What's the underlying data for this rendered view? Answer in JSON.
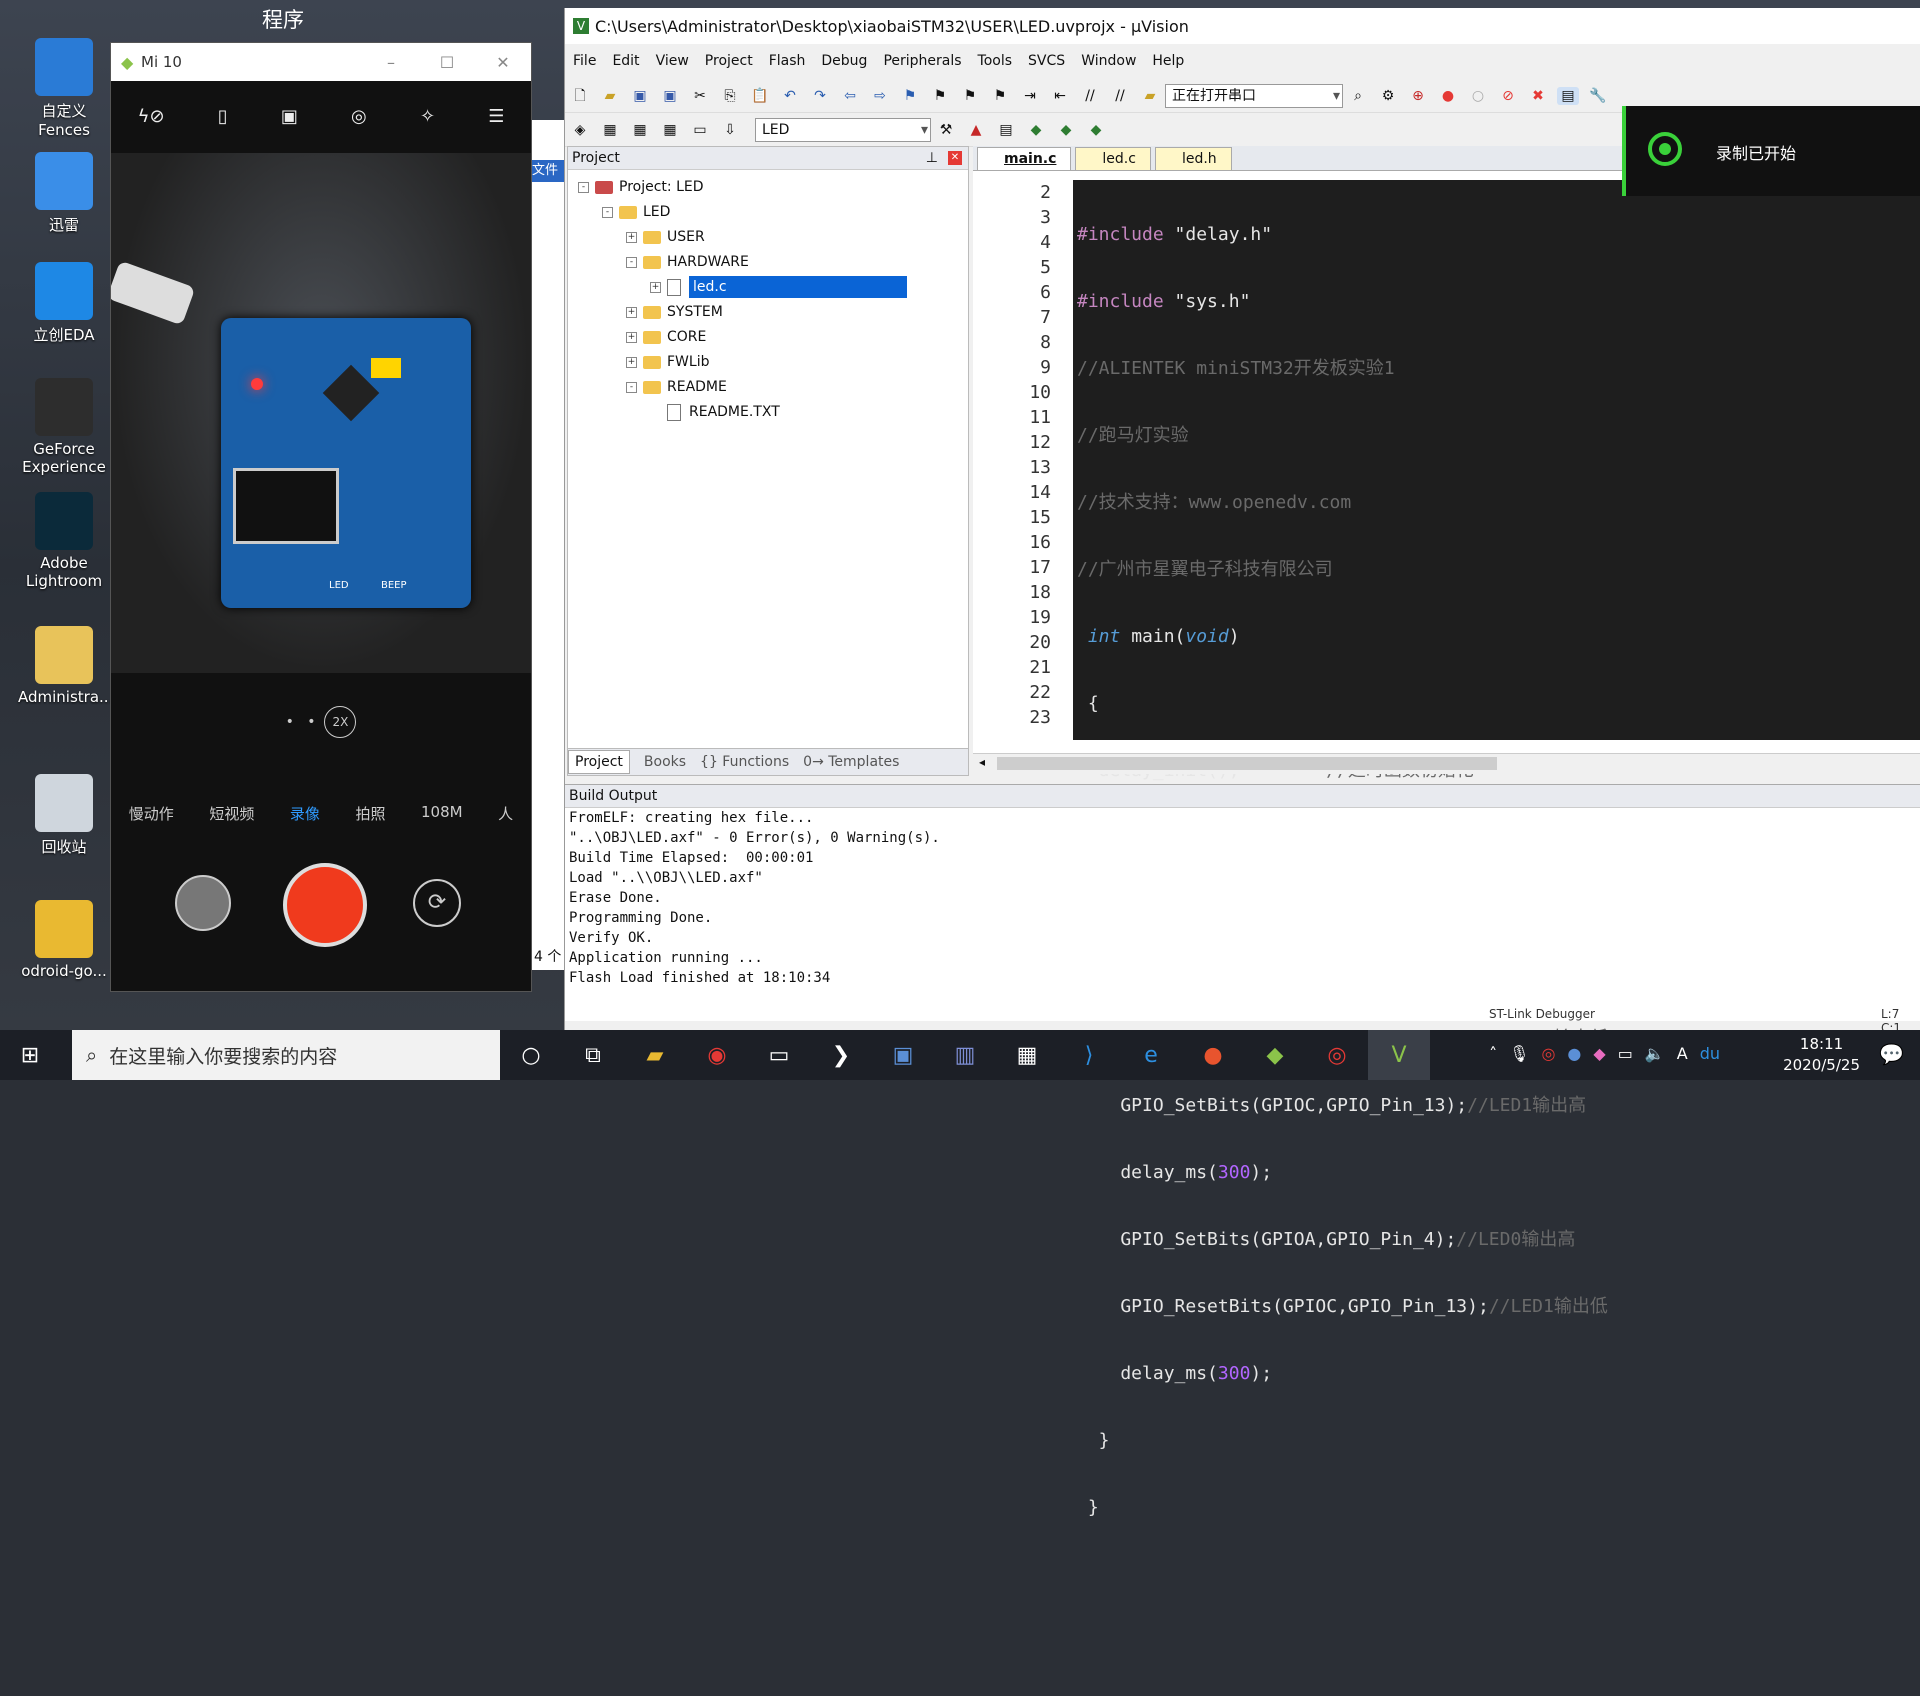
{
  "desktop": {
    "top_label": "程序",
    "icons": [
      {
        "label": "自定义\nFences",
        "icon": "fences-icon",
        "color": "#2a7bd6"
      },
      {
        "label": "迅雷",
        "icon": "xunlei-icon",
        "color": "#3a8ee8"
      },
      {
        "label": "立创EDA",
        "icon": "lceda-icon",
        "color": "#1e88e5"
      },
      {
        "label": "GeForce\nExperience",
        "icon": "geforce-icon",
        "color": "#2d2d2d"
      },
      {
        "label": "Adobe\nLightroom",
        "icon": "lightroom-icon",
        "color": "#0b2a3a"
      },
      {
        "label": "Administra...",
        "icon": "user-folder-icon",
        "color": "#e8c35a"
      },
      {
        "label": "回收站",
        "icon": "recycle-bin-icon",
        "color": "#cfd6dd"
      },
      {
        "label": "odroid-go...",
        "icon": "shortcut-icon",
        "color": "#e9b931"
      }
    ]
  },
  "phone": {
    "title": "Mi 10",
    "zoom": "2X",
    "modes": [
      "慢动作",
      "短视频",
      "录像",
      "拍照",
      "108M",
      "人"
    ],
    "active_mode": "录像",
    "board_labels": [
      "LED",
      "BEEP"
    ]
  },
  "uvision": {
    "title": "C:\\Users\\Administrator\\Desktop\\xiaobaiSTM32\\USER\\LED.uvprojx - µVision",
    "menu": [
      "File",
      "Edit",
      "View",
      "Project",
      "Flash",
      "Debug",
      "Peripherals",
      "Tools",
      "SVCS",
      "Window",
      "Help"
    ],
    "toolbar_combo": "正在打开串口",
    "target_combo": "LED",
    "project_panel": {
      "header": "Project",
      "tree": [
        {
          "label": "Project: LED",
          "level": 0,
          "type": "root",
          "exp": "-"
        },
        {
          "label": "LED",
          "level": 1,
          "type": "target",
          "exp": "-"
        },
        {
          "label": "USER",
          "level": 2,
          "type": "folder",
          "exp": "+"
        },
        {
          "label": "HARDWARE",
          "level": 2,
          "type": "folder",
          "exp": "-"
        },
        {
          "label": "led.c",
          "level": 3,
          "type": "file",
          "exp": "+",
          "selected": true
        },
        {
          "label": "SYSTEM",
          "level": 2,
          "type": "folder",
          "exp": "+"
        },
        {
          "label": "CORE",
          "level": 2,
          "type": "folder",
          "exp": "+"
        },
        {
          "label": "FWLib",
          "level": 2,
          "type": "folder",
          "exp": "+"
        },
        {
          "label": "README",
          "level": 2,
          "type": "folder",
          "exp": "-"
        },
        {
          "label": "README.TXT",
          "level": 3,
          "type": "file",
          "exp": ""
        }
      ],
      "tabs": [
        "Project",
        "Books",
        "{} Functions",
        "0→ Templates"
      ]
    },
    "editor": {
      "tabs": [
        "main.c",
        "led.c",
        "led.h"
      ],
      "active_tab": "main.c",
      "line_numbers": [
        "2",
        "3",
        "4",
        "5",
        "6",
        "7",
        "8",
        "9",
        "10",
        "11",
        "12",
        "13",
        "14",
        "15",
        "16",
        "17",
        "18",
        "19",
        "20",
        "21",
        "22",
        "23"
      ]
    },
    "build_output": {
      "header": "Build Output",
      "lines": [
        "FromELF: creating hex file...",
        "\"..\\OBJ\\LED.axf\" - 0 Error(s), 0 Warning(s).",
        "Build Time Elapsed:  00:00:01",
        "Load \"..\\\\OBJ\\\\LED.axf\"",
        "Erase Done.",
        "Programming Done.",
        "Verify OK.",
        "Application running ...",
        "Flash Load finished at 18:10:34"
      ]
    },
    "status": {
      "debugger": "ST-Link Debugger",
      "position": "L:7 C:1"
    }
  },
  "toast": {
    "text": "录制已开始"
  },
  "explorer_strip": {
    "label": "文件",
    "count": "4 个"
  },
  "taskbar": {
    "search_placeholder": "在这里输入你要搜索的内容",
    "time": "18:11",
    "date": "2020/5/25",
    "ime": "A"
  }
}
